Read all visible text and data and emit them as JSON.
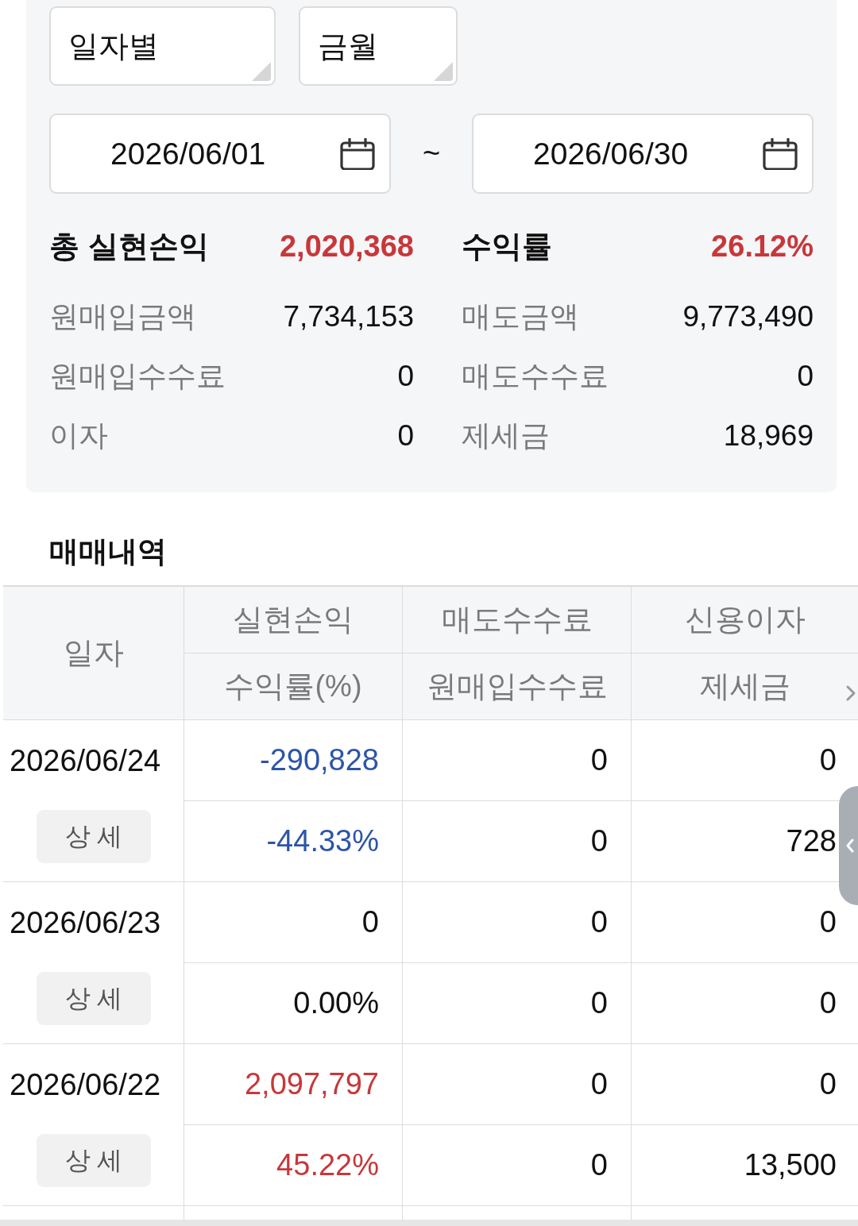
{
  "filters": {
    "dropdowns": [
      {
        "value": "일자별"
      },
      {
        "value": "금월"
      }
    ],
    "date_range": {
      "start": "2026/06/01",
      "separator": "~",
      "end": "2026/06/30"
    }
  },
  "summary": {
    "headline": [
      {
        "label": "총 실현손익",
        "value": "2,020,368",
        "color": "#c8373a"
      },
      {
        "label": "수익률",
        "value": "26.12%",
        "color": "#c8373a"
      }
    ],
    "items": [
      {
        "label": "원매입금액",
        "value": "7,734,153"
      },
      {
        "label": "매도금액",
        "value": "9,773,490"
      },
      {
        "label": "원매입수수료",
        "value": "0"
      },
      {
        "label": "매도수수료",
        "value": "0"
      },
      {
        "label": "이자",
        "value": "0"
      },
      {
        "label": "제세금",
        "value": "18,969"
      }
    ]
  },
  "trade_history": {
    "title": "매매내역",
    "columns": [
      {
        "top": "일자"
      },
      {
        "top": "실현손익",
        "bottom": "수익률(%)"
      },
      {
        "top": "매도수수료",
        "bottom": "원매입수수료"
      },
      {
        "top": "신용이자",
        "bottom": "제세금"
      }
    ],
    "rows": [
      {
        "date": "2026/06/24",
        "detail_button": "상 세",
        "color": "#2c55a8",
        "realized_pl": "-290,828",
        "sell_fee": "0",
        "credit_interest": "0",
        "return_rate": "-44.33%",
        "buy_fee": "0",
        "tax": "728"
      },
      {
        "date": "2026/06/23",
        "detail_button": "상 세",
        "color": "#111111",
        "realized_pl": "0",
        "sell_fee": "0",
        "credit_interest": "0",
        "return_rate": "0.00%",
        "buy_fee": "0",
        "tax": "0"
      },
      {
        "date": "2026/06/22",
        "detail_button": "상 세",
        "color": "#c8373a",
        "realized_pl": "2,097,797",
        "sell_fee": "0",
        "credit_interest": "0",
        "return_rate": "45.22%",
        "buy_fee": "0",
        "tax": "13,500"
      }
    ]
  }
}
